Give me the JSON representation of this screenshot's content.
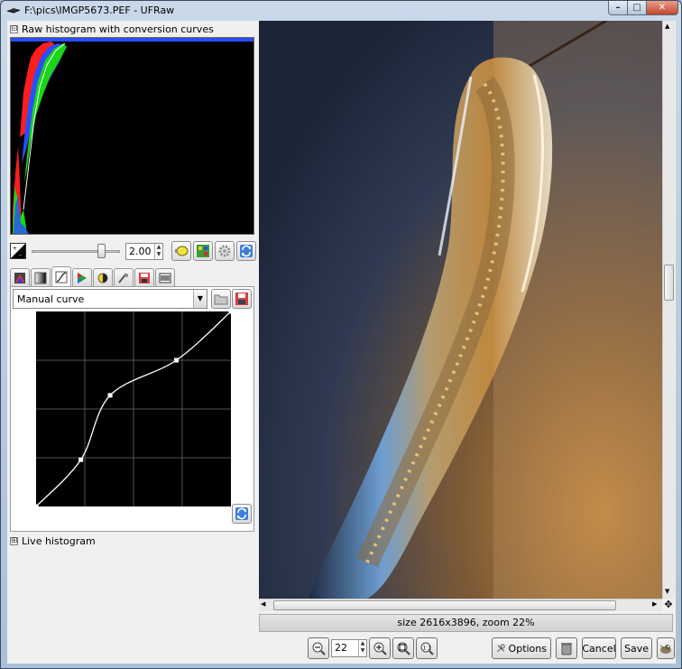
{
  "window": {
    "title": "F:\\pics\\IMGP5673.PEF - UFRaw",
    "controls": {
      "minimize": "–",
      "maximize": "□",
      "close": "✕"
    }
  },
  "raw_histogram": {
    "toggle": "⊟",
    "label": "Raw histogram with conversion curves"
  },
  "exposure": {
    "value": "2.00",
    "slider_fraction": 0.82
  },
  "tabs": [
    {
      "name": "white-balance"
    },
    {
      "name": "grayscale"
    },
    {
      "name": "base-curve"
    },
    {
      "name": "color-management"
    },
    {
      "name": "correct-luminosity"
    },
    {
      "name": "lens-correction"
    },
    {
      "name": "save-settings"
    },
    {
      "name": "exif"
    }
  ],
  "curve": {
    "preset": "Manual curve",
    "points": [
      [
        0,
        0
      ],
      [
        0.23,
        0.24
      ],
      [
        0.38,
        0.57
      ],
      [
        0.72,
        0.75
      ],
      [
        1,
        1
      ]
    ]
  },
  "live_histogram": {
    "toggle": "⊞",
    "label": "Live histogram"
  },
  "preview": {
    "status": "size 2616x3896, zoom 22%"
  },
  "toolbar": {
    "zoom_value": "22",
    "options_label": "Options",
    "cancel_label": "Cancel",
    "save_label": "Save"
  },
  "colors": {
    "histogram_red": "#ff1d1d",
    "histogram_green": "#18d618",
    "histogram_blue": "#2a4dff",
    "close_button": "#c3442b"
  }
}
